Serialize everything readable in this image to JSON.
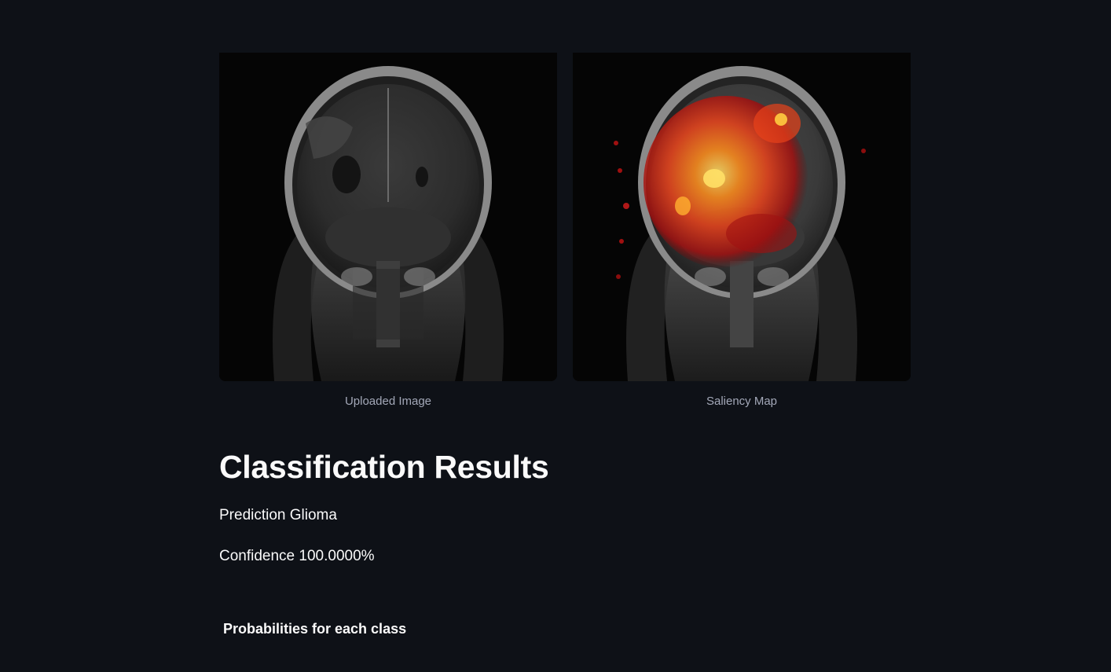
{
  "images": {
    "uploaded": {
      "caption": "Uploaded Image"
    },
    "saliency": {
      "caption": "Saliency Map"
    }
  },
  "results": {
    "title": "Classification Results",
    "prediction_text": "Prediction Glioma",
    "confidence_text": "Confidence 100.0000%",
    "probabilities_heading": "Probabilities for each class"
  },
  "colors": {
    "background": "#0e1117",
    "text": "#fafafa",
    "caption": "#a3a8b8",
    "heat_low": "#8b0d0d",
    "heat_mid": "#e8421a",
    "heat_high": "#ffe066"
  }
}
